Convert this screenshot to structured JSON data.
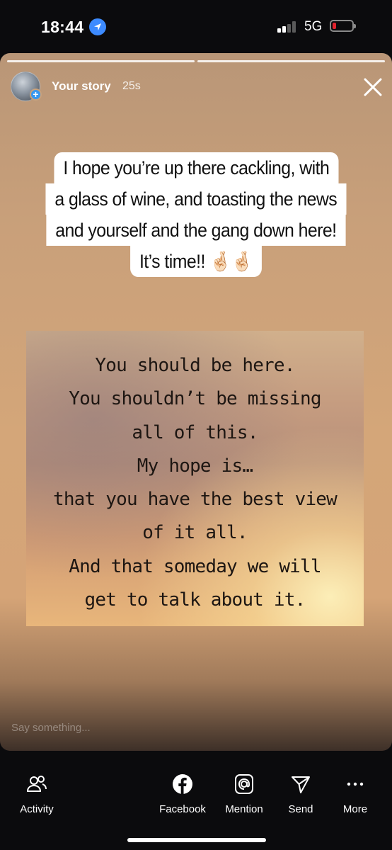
{
  "status_bar": {
    "time": "18:44",
    "network": "5G"
  },
  "story": {
    "user": "Your story",
    "time_ago": "25s",
    "caption_lines": [
      "I hope you’re up there cackling, with",
      "a glass of wine, and toasting the news",
      "and yourself and the gang down here!",
      "It’s time!! 🤞🏻🤞🏻"
    ],
    "quote_lines": [
      "You should be here.",
      "You shouldn’t be missing",
      "all of this.",
      "My hope is…",
      "that you have the best view",
      "of it all.",
      "And that someday we will",
      "get to talk about it."
    ],
    "reply_placeholder": "Say something..."
  },
  "actions": [
    {
      "label": "Activity",
      "icon": "activity-icon"
    },
    {
      "label": "Facebook",
      "icon": "facebook-icon"
    },
    {
      "label": "Mention",
      "icon": "mention-icon"
    },
    {
      "label": "Send",
      "icon": "send-icon"
    },
    {
      "label": "More",
      "icon": "more-icon"
    }
  ],
  "colors": {
    "accent": "#3797f0",
    "battery_low": "#e2222d"
  }
}
